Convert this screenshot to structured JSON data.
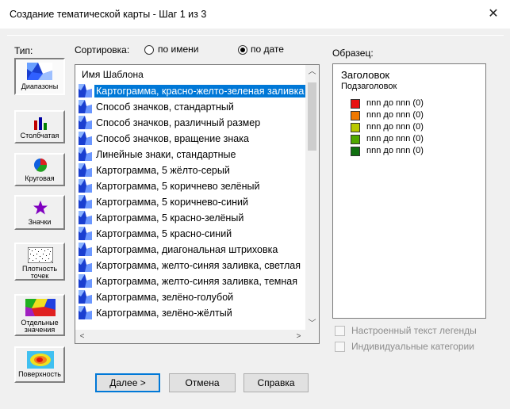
{
  "window": {
    "title": "Создание тематической карты - Шаг 1 из 3",
    "close_glyph": "✕"
  },
  "type_panel": {
    "label": "Тип:",
    "buttons": [
      {
        "label": "Диапазоны",
        "icon": "ranges-map-icon",
        "selected": true
      },
      {
        "label": "Столбчатая",
        "icon": "bar-chart-icon"
      },
      {
        "label": "Круговая",
        "icon": "pie-chart-icon"
      },
      {
        "label": "Значки",
        "icon": "star-symbol-icon"
      },
      {
        "label": "Плотность точек",
        "icon": "dot-density-icon"
      },
      {
        "label": "Отдельные значения",
        "icon": "individual-values-map-icon"
      },
      {
        "label": "Поверхность",
        "icon": "surface-grid-icon"
      }
    ]
  },
  "sort": {
    "label": "Сортировка:",
    "by_name": "по имени",
    "by_date": "по дате",
    "selected": "by_date"
  },
  "template_list": {
    "header": "Имя Шаблона",
    "items": [
      "Картограмма, красно-желто-зеленая заливка",
      "Способ значков, стандартный",
      "Способ значков, различный размер",
      "Способ значков, вращение знака",
      "Линейные знаки, стандартные",
      "Картограмма, 5 жёлто-серый",
      "Картограмма, 5 коричнево зелёный",
      "Картограмма, 5 коричнево-синий",
      "Картограмма, 5 красно-зелёный",
      "Картограмма, 5 красно-синий",
      "Картограмма, диагональная штриховка",
      "Картограмма, желто-синяя заливка, светлая",
      "Картограмма, желто-синяя заливка, темная",
      "Картограмма, зелёно-голубой",
      "Картограмма, зелёно-жёлтый"
    ],
    "selected_index": 0
  },
  "sample": {
    "label": "Образец:",
    "title": "Заголовок",
    "subtitle": "Подзаголовок",
    "legend": [
      {
        "text": "nnn до nnn  (0)",
        "color": "#e81010"
      },
      {
        "text": "nnn до nnn  (0)",
        "color": "#f07800"
      },
      {
        "text": "nnn до nnn  (0)",
        "color": "#b8c800"
      },
      {
        "text": "nnn до nnn  (0)",
        "color": "#50a800"
      },
      {
        "text": "nnn до nnn  (0)",
        "color": "#107010"
      }
    ]
  },
  "options": {
    "custom_legend_text": "Настроенный текст легенды",
    "individual_categories": "Индивидуальные категории"
  },
  "buttons": {
    "next": "Далее >",
    "cancel": "Отмена",
    "help": "Справка"
  }
}
